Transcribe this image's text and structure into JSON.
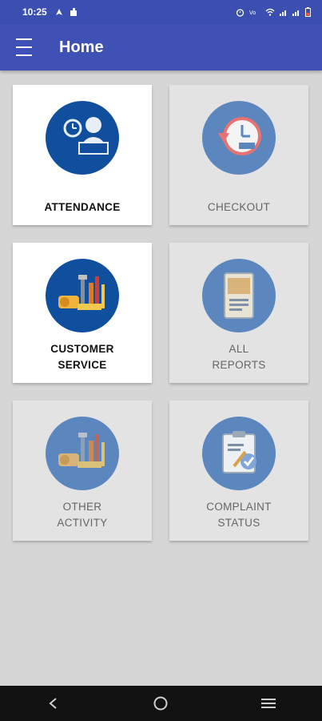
{
  "status_bar": {
    "time": "10:25",
    "left_icons": [
      "navigation-icon",
      "notification-puzzle-icon"
    ],
    "right_icons": [
      "alarm-icon",
      "volte-icon",
      "wifi-icon",
      "signal-icon",
      "signal-icon",
      "battery-icon"
    ]
  },
  "app_bar": {
    "title": "Home",
    "menu_icon": "hamburger-menu-icon",
    "color": "#3f51b5"
  },
  "tiles": [
    {
      "line1": "ATTENDANCE",
      "line2": "",
      "icon": "attendance-person-clock-icon",
      "enabled": true
    },
    {
      "line1": "CHECKOUT",
      "line2": "",
      "icon": "checkout-clock-icon",
      "enabled": false
    },
    {
      "line1": "CUSTOMER",
      "line2": "SERVICE",
      "icon": "tools-service-icon",
      "enabled": true
    },
    {
      "line1": "ALL",
      "line2": "REPORTS",
      "icon": "reports-document-icon",
      "enabled": false
    },
    {
      "line1": "OTHER",
      "line2": "ACTIVITY",
      "icon": "tools-activity-icon",
      "enabled": false
    },
    {
      "line1": "COMPLAINT",
      "line2": "STATUS",
      "icon": "clipboard-check-icon",
      "enabled": false
    }
  ],
  "nav_bar": {
    "icons": [
      "back-icon",
      "home-icon",
      "recents-icon"
    ]
  }
}
